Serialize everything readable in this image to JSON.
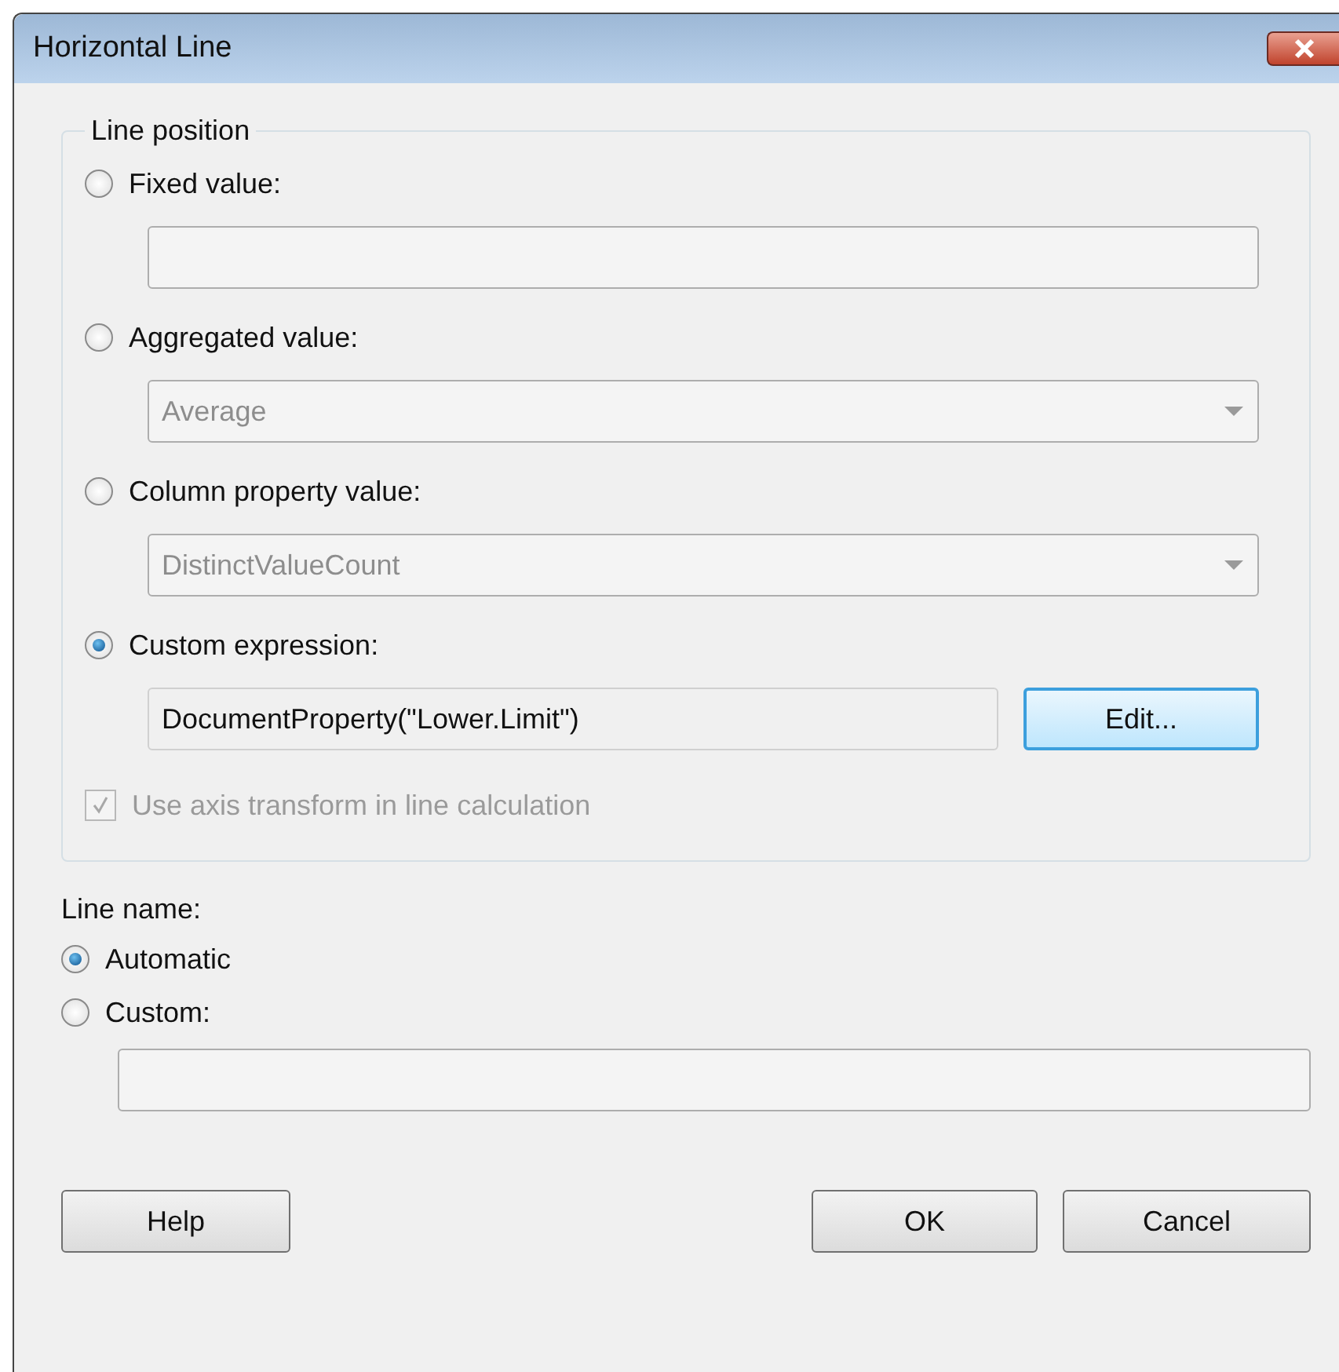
{
  "window": {
    "title": "Horizontal Line"
  },
  "line_position": {
    "label": "Line position",
    "options": [
      {
        "label": "Fixed value:",
        "selected": false,
        "kind": "text",
        "disabled": true
      },
      {
        "label": "Aggregated value:",
        "selected": false,
        "kind": "dropdown",
        "value": "Average",
        "disabled": true
      },
      {
        "label": "Column property value:",
        "selected": false,
        "kind": "dropdown",
        "value": "DistinctValueCount",
        "disabled": true
      },
      {
        "label": "Custom expression:",
        "selected": true,
        "kind": "expression",
        "value": "DocumentProperty(\"Lower.Limit\")",
        "button": "Edit..."
      }
    ],
    "axis_transform": {
      "label": "Use axis transform in line calculation",
      "checked": true,
      "disabled": true
    }
  },
  "line_name": {
    "label": "Line name:",
    "options": [
      {
        "label": "Automatic",
        "selected": true
      },
      {
        "label": "Custom:",
        "selected": false
      }
    ]
  },
  "buttons": {
    "help": "Help",
    "ok": "OK",
    "cancel": "Cancel"
  }
}
